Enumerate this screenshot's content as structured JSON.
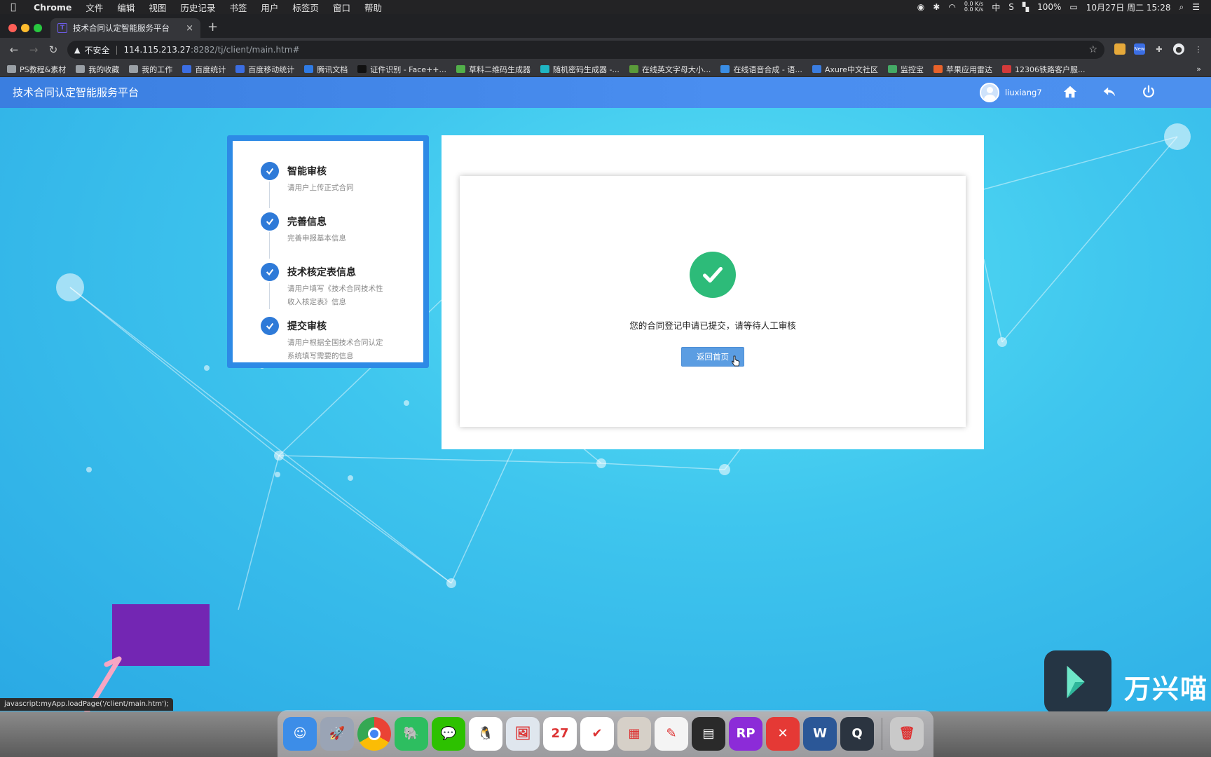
{
  "menubar": {
    "app": "Chrome",
    "items": [
      "文件",
      "编辑",
      "视图",
      "历史记录",
      "书签",
      "用户",
      "标签页",
      "窗口",
      "帮助"
    ],
    "net_up": "0.0 K/s",
    "net_down": "0.0 K/s",
    "ime": "中",
    "battery": "100%",
    "datetime": "10月27日 周二  15:28"
  },
  "tab": {
    "title": "技术合同认定智能服务平台",
    "close": "×",
    "new_tab": "+"
  },
  "address": {
    "warning": "不安全",
    "host": "114.115.213.27",
    "path": ":8282/tj/client/main.htm#"
  },
  "bookmarks": [
    {
      "label": "PS教程&素材",
      "color": "#9aa0a6"
    },
    {
      "label": "我的收藏",
      "color": "#9aa0a6"
    },
    {
      "label": "我的工作",
      "color": "#9aa0a6"
    },
    {
      "label": "百度统计",
      "color": "#3b6ee3"
    },
    {
      "label": "百度移动统计",
      "color": "#3b6ee3"
    },
    {
      "label": "腾讯文档",
      "color": "#2f7be5"
    },
    {
      "label": "证件识别 - Face++...",
      "color": "#111111"
    },
    {
      "label": "草料二维码生成器",
      "color": "#52b04a"
    },
    {
      "label": "随机密码生成器 -...",
      "color": "#1fb6c4"
    },
    {
      "label": "在线英文字母大小...",
      "color": "#5a9b3a"
    },
    {
      "label": "在线语音合成 - 语...",
      "color": "#3a8ee6"
    },
    {
      "label": "Axure中文社区",
      "color": "#3a7de0"
    },
    {
      "label": "监控宝",
      "color": "#44aa66"
    },
    {
      "label": "苹果应用雷达",
      "color": "#e8622a"
    },
    {
      "label": "12306铁路客户服...",
      "color": "#d33a3a"
    }
  ],
  "bookmarks_more": "»",
  "app": {
    "title": "技术合同认定智能服务平台",
    "username": "liuxiang7"
  },
  "steps": [
    {
      "title": "智能审核",
      "desc": "请用户上传正式合同"
    },
    {
      "title": "完善信息",
      "desc": "完善申报基本信息"
    },
    {
      "title": "技术核定表信息",
      "desc": "请用户填写《技术合同技术性收入核定表》信息"
    },
    {
      "title": "提交审核",
      "desc": "请用户根据全国技术合同认定系统填写需要的信息"
    }
  ],
  "result": {
    "message": "您的合同登记申请已提交，请等待人工审核",
    "back_button": "返回首页"
  },
  "status_url": "javascript:myApp.loadPage('/client/main.htm');",
  "watermark": {
    "text": "万兴喵"
  },
  "overlay_color": "#7326b3",
  "dock": [
    {
      "name": "finder",
      "bg": "#3c8de8",
      "glyph": "☺"
    },
    {
      "name": "launchpad",
      "bg": "#9aa4b5",
      "glyph": "🚀"
    },
    {
      "name": "chrome",
      "bg": "#ffffff",
      "glyph": ""
    },
    {
      "name": "evernote",
      "bg": "#2dbe60",
      "glyph": "🐘"
    },
    {
      "name": "wechat",
      "bg": "#2dc100",
      "glyph": "💬"
    },
    {
      "name": "qq",
      "bg": "#ffffff",
      "glyph": "🐧"
    },
    {
      "name": "preview",
      "bg": "#dfe6ee",
      "glyph": "🖼"
    },
    {
      "name": "calendar",
      "bg": "#ffffff",
      "glyph": "27"
    },
    {
      "name": "todo",
      "bg": "#ffffff",
      "glyph": "✔"
    },
    {
      "name": "calculator",
      "bg": "#d6d0c8",
      "glyph": "▦"
    },
    {
      "name": "textedit",
      "bg": "#f4f4f4",
      "glyph": "✎"
    },
    {
      "name": "monitor",
      "bg": "#2a2a2a",
      "glyph": "▤"
    },
    {
      "name": "axure-rp",
      "bg": "#8c2bd8",
      "glyph": "RP"
    },
    {
      "name": "xmind",
      "bg": "#e53935",
      "glyph": "✕"
    },
    {
      "name": "word",
      "bg": "#2b5797",
      "glyph": "W"
    },
    {
      "name": "quicktime",
      "bg": "#2b3440",
      "glyph": "Q"
    },
    {
      "name": "trash",
      "bg": "#c9c9c9",
      "glyph": "🗑"
    }
  ]
}
